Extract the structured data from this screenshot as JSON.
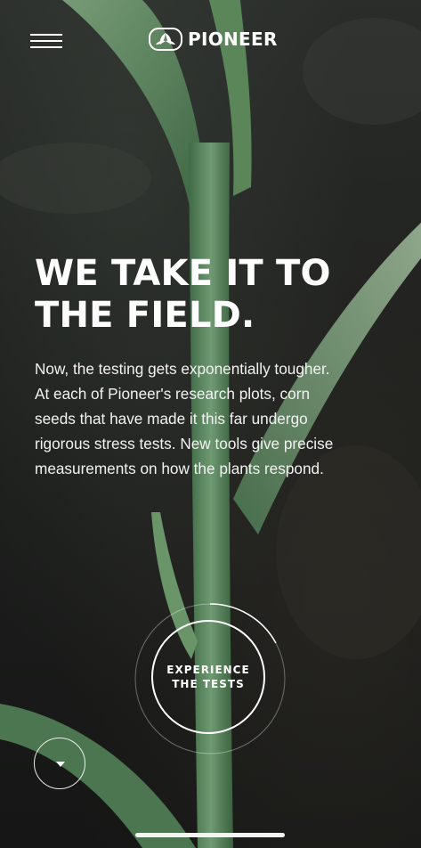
{
  "header": {
    "brand": "PIONEER"
  },
  "hero": {
    "headline_lines": [
      "WE TAKE IT TO",
      "THE FIELD."
    ],
    "body_lines": [
      "Now, the testing gets exponentially tougher.",
      "At each of Pioneer's research plots, corn",
      "seeds that have made it this far undergo",
      "rigorous stress tests. New tools give precise",
      "measurements on how the plants respond."
    ]
  },
  "cta": {
    "label_lines": [
      "EXPERIENCE",
      "THE TESTS"
    ]
  },
  "icons": {
    "menu": "hamburger-menu-icon",
    "logo": "pioneer-logo-mark",
    "scroll": "chevron-down-icon"
  },
  "colors": {
    "text": "#ffffff",
    "leaf": "#5e8a5e",
    "background": "#1f211f"
  }
}
